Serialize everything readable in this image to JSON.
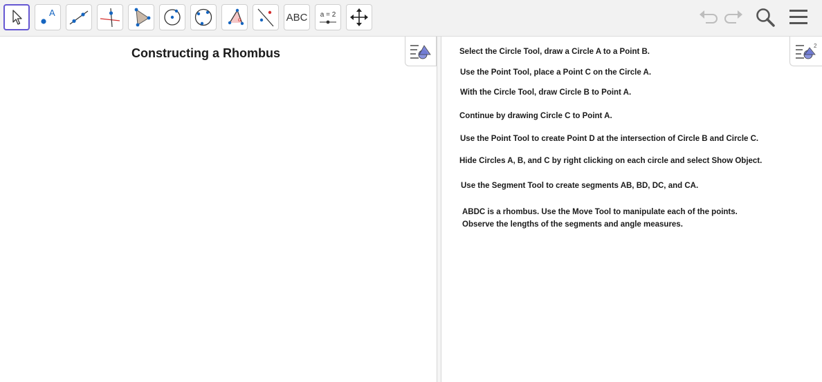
{
  "toolbar": {
    "tools": [
      {
        "name": "move-tool",
        "icon": "cursor-arrow-icon"
      },
      {
        "name": "point-tool",
        "icon": "point-icon",
        "label": "A"
      },
      {
        "name": "line-tool",
        "icon": "line-through-points-icon"
      },
      {
        "name": "perpendicular-line-tool",
        "icon": "perpendicular-line-icon"
      },
      {
        "name": "polygon-tool",
        "icon": "polygon-icon"
      },
      {
        "name": "circle-tool",
        "icon": "circle-center-point-icon"
      },
      {
        "name": "circle-three-points-tool",
        "icon": "circle-three-points-icon"
      },
      {
        "name": "angle-tool",
        "icon": "angle-icon"
      },
      {
        "name": "reflect-tool",
        "icon": "reflect-about-line-icon"
      },
      {
        "name": "text-tool",
        "icon": "text-icon",
        "label": "ABC"
      },
      {
        "name": "slider-tool",
        "icon": "slider-icon",
        "label": "a = 2"
      },
      {
        "name": "move-graphics-view-tool",
        "icon": "move-arrows-icon"
      }
    ],
    "undo_icon": "undo-icon",
    "redo_icon": "redo-icon",
    "search_icon": "search-icon",
    "menu_icon": "hamburger-menu-icon"
  },
  "graphics": {
    "title": "Constructing a Rhombus",
    "style_bar_icon": "style-bar-toggle-icon"
  },
  "graphics2": {
    "style_bar_icon": "style-bar-toggle-icon",
    "instructions": [
      {
        "text": "Select the Circle Tool, draw a Circle A to a Point B."
      },
      {
        "text": "Use the Point Tool, place a Point C on the Circle A."
      },
      {
        "text": "With the Circle Tool, draw Circle B to Point A."
      },
      {
        "text": "Continue by drawing Circle C to Point A."
      },
      {
        "text": "Use the Point Tool to create Point D at the intersection of Circle B and Circle C."
      },
      {
        "text": "Hide Circles A, B, and C by right clicking on each circle and select Show Object."
      },
      {
        "text": "Use the Segment Tool to create segments AB, BD, DC, and CA."
      },
      {
        "text": "ABDC is a rhombus. Use the Move Tool to manipulate each of the points."
      },
      {
        "text": "Observe the lengths of the segments and angle measures."
      }
    ]
  },
  "colors": {
    "accent": "#6557d2",
    "point": "#1565c0",
    "red_line": "#d32f2f"
  }
}
